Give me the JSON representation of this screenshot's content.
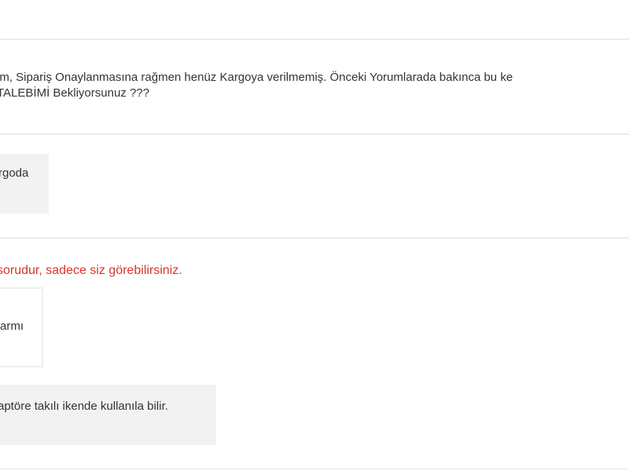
{
  "thread": {
    "question": {
      "line1": "im, Sipariş Onaylanmasına rağmen henüz Kargoya verilmemiş. Önceki Yorumlarada bakınca bu ke",
      "line2": "TALEBİMİ Bekliyorsunuz ???"
    },
    "first_reply": {
      "text": "rgoda"
    },
    "private_notice": "sorudur, sadece siz görebilirsiniz.",
    "private_question": {
      "text": "rarmı"
    },
    "private_answer": {
      "text": "aptöre takılı ikende kullanıla bilir."
    }
  },
  "colors": {
    "divider": "#e6e6e6",
    "bubble_grey": "#f2f2f2",
    "notice_red": "#d9342b",
    "text": "#333333"
  }
}
